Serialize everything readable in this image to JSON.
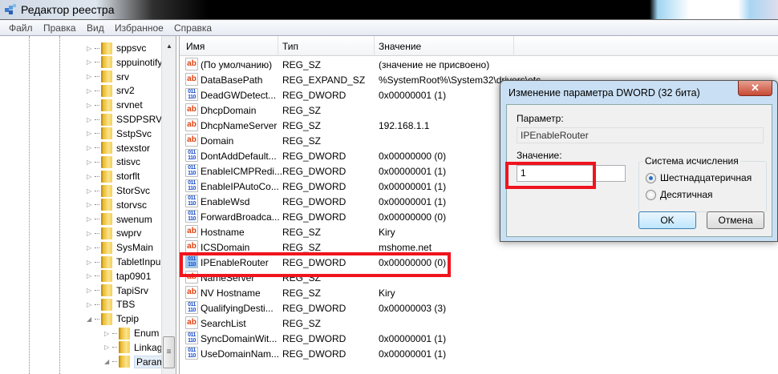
{
  "window": {
    "title": "Редактор реестра"
  },
  "menu": [
    "Файл",
    "Правка",
    "Вид",
    "Избранное",
    "Справка"
  ],
  "tree": {
    "items": [
      {
        "label": "sppsvc",
        "level": 0
      },
      {
        "label": "sppuinotify",
        "level": 0
      },
      {
        "label": "srv",
        "level": 0
      },
      {
        "label": "srv2",
        "level": 0
      },
      {
        "label": "srvnet",
        "level": 0
      },
      {
        "label": "SSDPSRV",
        "level": 0
      },
      {
        "label": "SstpSvc",
        "level": 0
      },
      {
        "label": "stexstor",
        "level": 0
      },
      {
        "label": "stisvc",
        "level": 0
      },
      {
        "label": "storflt",
        "level": 0
      },
      {
        "label": "StorSvc",
        "level": 0
      },
      {
        "label": "storvsc",
        "level": 0
      },
      {
        "label": "swenum",
        "level": 0
      },
      {
        "label": "swprv",
        "level": 0
      },
      {
        "label": "SysMain",
        "level": 0
      },
      {
        "label": "TabletInpu",
        "level": 0
      },
      {
        "label": "tap0901",
        "level": 0
      },
      {
        "label": "TapiSrv",
        "level": 0
      },
      {
        "label": "TBS",
        "level": 0
      },
      {
        "label": "Tcpip",
        "level": 0,
        "expanded": true
      },
      {
        "label": "Enum",
        "level": 1
      },
      {
        "label": "Linkage",
        "level": 1
      },
      {
        "label": "Parame",
        "level": 1,
        "expanded": true,
        "selected": true
      }
    ]
  },
  "list": {
    "columns": [
      "Имя",
      "Тип",
      "Значение"
    ],
    "rows": [
      {
        "name": "(По умолчанию)",
        "type": "REG_SZ",
        "value": "(значение не присвоено)",
        "icon": "sz"
      },
      {
        "name": "DataBasePath",
        "type": "REG_EXPAND_SZ",
        "value": "%SystemRoot%\\System32\\drivers\\etc",
        "icon": "sz"
      },
      {
        "name": "DeadGWDetect...",
        "type": "REG_DWORD",
        "value": "0x00000001 (1)",
        "icon": "dw"
      },
      {
        "name": "DhcpDomain",
        "type": "REG_SZ",
        "value": "",
        "icon": "sz"
      },
      {
        "name": "DhcpNameServer",
        "type": "REG_SZ",
        "value": "192.168.1.1",
        "icon": "sz"
      },
      {
        "name": "Domain",
        "type": "REG_SZ",
        "value": "",
        "icon": "sz"
      },
      {
        "name": "DontAddDefault...",
        "type": "REG_DWORD",
        "value": "0x00000000 (0)",
        "icon": "dw"
      },
      {
        "name": "EnableICMPRedi...",
        "type": "REG_DWORD",
        "value": "0x00000001 (1)",
        "icon": "dw"
      },
      {
        "name": "EnableIPAutoCo...",
        "type": "REG_DWORD",
        "value": "0x00000001 (1)",
        "icon": "dw"
      },
      {
        "name": "EnableWsd",
        "type": "REG_DWORD",
        "value": "0x00000001 (1)",
        "icon": "dw"
      },
      {
        "name": "ForwardBroadca...",
        "type": "REG_DWORD",
        "value": "0x00000000 (0)",
        "icon": "dw"
      },
      {
        "name": "Hostname",
        "type": "REG_SZ",
        "value": "Kiry",
        "icon": "sz"
      },
      {
        "name": "ICSDomain",
        "type": "REG_SZ",
        "value": "mshome.net",
        "icon": "sz"
      },
      {
        "name": "IPEnableRouter",
        "type": "REG_DWORD",
        "value": "0x00000000 (0)",
        "icon": "dw",
        "selected": true
      },
      {
        "name": "NameServer",
        "type": "REG_SZ",
        "value": "",
        "icon": "sz"
      },
      {
        "name": "NV Hostname",
        "type": "REG_SZ",
        "value": "Kiry",
        "icon": "sz"
      },
      {
        "name": "QualifyingDesti...",
        "type": "REG_DWORD",
        "value": "0x00000003 (3)",
        "icon": "dw"
      },
      {
        "name": "SearchList",
        "type": "REG_SZ",
        "value": "",
        "icon": "sz"
      },
      {
        "name": "SyncDomainWit...",
        "type": "REG_DWORD",
        "value": "0x00000001 (1)",
        "icon": "dw"
      },
      {
        "name": "UseDomainNam...",
        "type": "REG_DWORD",
        "value": "0x00000001 (1)",
        "icon": "dw"
      }
    ]
  },
  "dialog": {
    "title": "Изменение параметра DWORD (32 бита)",
    "close": "✕",
    "param_label": "Параметр:",
    "param_value": "IPEnableRouter",
    "value_label": "Значение:",
    "value": "1",
    "base_label": "Система исчисления",
    "hex_label": "Шестнадцатеричная",
    "dec_label": "Десятичная",
    "base_selected": "hex",
    "ok": "OK",
    "cancel": "Отмена"
  },
  "colors": {
    "highlight": "#f0141e"
  }
}
